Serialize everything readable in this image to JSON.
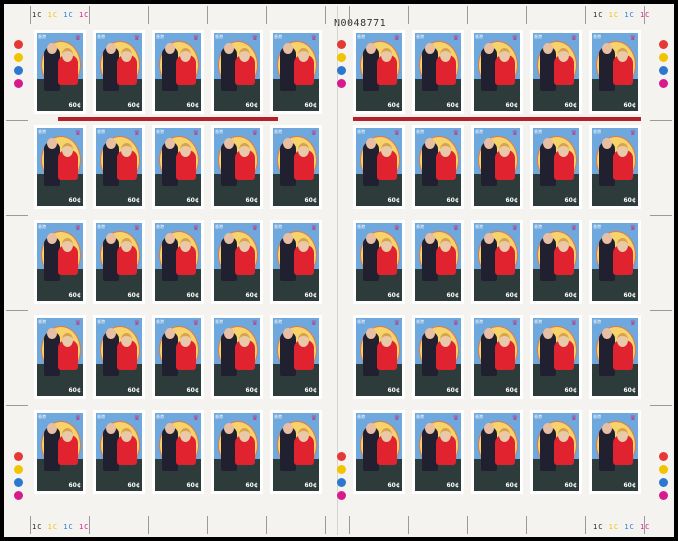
{
  "sheet": {
    "serial_number": "N0048771",
    "traffic_light_label": "1C 1C 1C 1C",
    "traffic_light_colors": [
      "#e53935",
      "#f2c400",
      "#2c78d0",
      "#d81b8c"
    ],
    "sheet_color": "#f4f3ef",
    "background_color": "#000000"
  },
  "stamp": {
    "country_text": "香港",
    "country_text_en": "HONG KONG",
    "denomination": "60¢",
    "crest_icon": "crown-icon",
    "subject": "royal-couple-portrait",
    "colors": {
      "sky": "#6fa8dc",
      "halo": "#f6d36b",
      "dress": "#e0232e",
      "suit": "#202030",
      "buildings": "#2d3b3b",
      "caption_band": "#b3202a"
    }
  },
  "panes": {
    "count": 2,
    "rows": 5,
    "columns_per_pane": 5,
    "total_stamps": 50
  }
}
